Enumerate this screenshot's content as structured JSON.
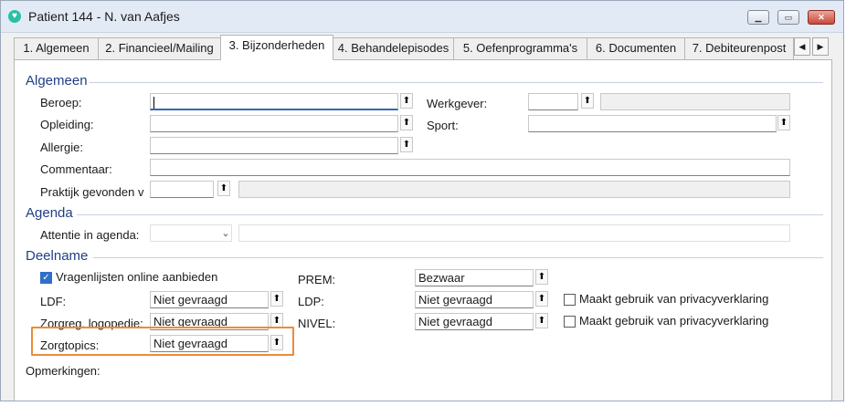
{
  "window": {
    "title": "Patient 144 - N. van Aafjes",
    "icon": "heart-icon"
  },
  "tabs": [
    "1. Algemeen",
    "2. Financieel/Mailing",
    "3. Bijzonderheden",
    "4. Behandelepisodes",
    "5. Oefenprogramma's",
    "6. Documenten",
    "7. Debiteurenpost"
  ],
  "active_tab": "3. Bijzonderheden",
  "algemeen": {
    "title": "Algemeen",
    "beroep_label": "Beroep:",
    "beroep_value": "",
    "opleiding_label": "Opleiding:",
    "allergie_label": "Allergie:",
    "commentaar_label": "Commentaar:",
    "praktijk_label": "Praktijk gevonden v",
    "werkgever_label": "Werkgever:",
    "sport_label": "Sport:"
  },
  "agenda": {
    "title": "Agenda",
    "attentie_label": "Attentie in agenda:"
  },
  "deelname": {
    "title": "Deelname",
    "vragenlijsten_label": "Vragenlijsten online aanbieden",
    "vragenlijsten_checked": true,
    "ldf_label": "LDF:",
    "ldf_value": "Niet gevraagd",
    "zorgreg_label": "Zorgreg. logopedie:",
    "zorgreg_value": "Niet gevraagd",
    "zorgtopics_label": "Zorgtopics:",
    "zorgtopics_value": "Niet gevraagd",
    "prem_label": "PREM:",
    "prem_value": "Bezwaar",
    "ldp_label": "LDP:",
    "ldp_value": "Niet gevraagd",
    "nivel_label": "NIVEL:",
    "nivel_value": "Niet gevraagd",
    "privacy_label_1": "Maakt gebruik van privacyverklaring",
    "privacy_label_2": "Maakt gebruik van privacyverklaring",
    "opmerkingen_label": "Opmerkingen:"
  },
  "colors": {
    "section_title": "#1f3f85",
    "highlight": "#ec8b3c",
    "checkbox": "#2f6fc9"
  }
}
